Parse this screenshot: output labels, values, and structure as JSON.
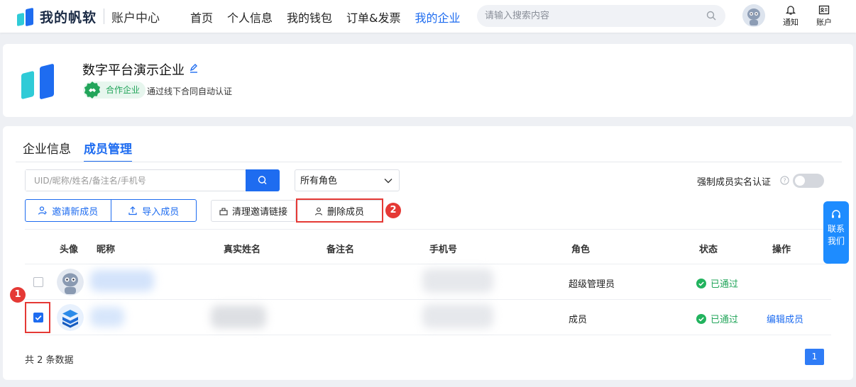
{
  "header": {
    "brand": "我的帆软",
    "section": "账户中心",
    "nav": [
      "首页",
      "个人信息",
      "我的钱包",
      "订单&发票",
      "我的企业"
    ],
    "active_nav": "我的企业",
    "search_placeholder": "请输入搜索内容",
    "notify_label": "通知",
    "account_label": "账户"
  },
  "company": {
    "name": "数字平台演示企业",
    "badge": "合作企业",
    "badge_note": "通过线下合同自动认证"
  },
  "tabs": [
    "企业信息",
    "成员管理"
  ],
  "active_tab": "成员管理",
  "filters": {
    "search_placeholder": "UID/昵称/姓名/备注名/手机号",
    "role_select": "所有角色",
    "force_realname_label": "强制成员实名认证",
    "force_realname_on": false
  },
  "actions": {
    "invite": "邀请新成员",
    "import": "导入成员",
    "clear_links": "清理邀请链接",
    "delete": "删除成员"
  },
  "annotations": {
    "step1": "1",
    "step2": "2"
  },
  "table": {
    "columns": [
      "头像",
      "昵称",
      "真实姓名",
      "备注名",
      "手机号",
      "角色",
      "状态",
      "操作"
    ],
    "rows": [
      {
        "checked": false,
        "role": "超级管理员",
        "status": "已通过",
        "action": ""
      },
      {
        "checked": true,
        "role": "成员",
        "status": "已通过",
        "action": "编辑成员"
      }
    ]
  },
  "pagination": {
    "total_text": "共 2 条数据",
    "current_page": "1"
  },
  "float_contact": {
    "line1": "联系",
    "line2": "我们"
  },
  "colors": {
    "primary": "#1e6cf0",
    "success": "#22a55a",
    "annotation": "#e53935"
  }
}
